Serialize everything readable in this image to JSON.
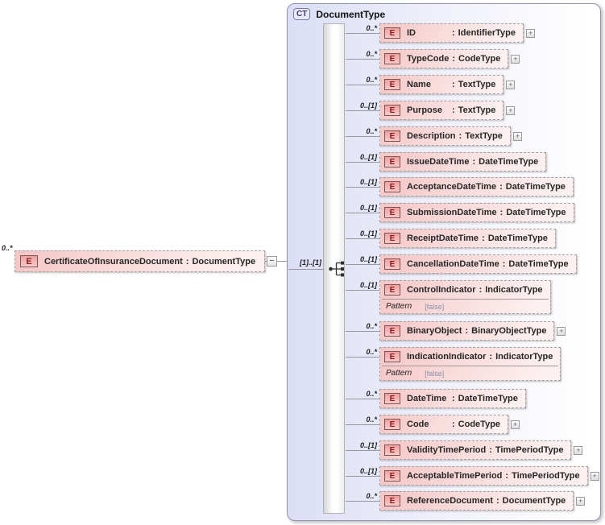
{
  "labels": {
    "colon": ":",
    "element_badge": "E",
    "expand_glyph": "+",
    "collapse_glyph": "−"
  },
  "root_element": {
    "cardinality": "0..*",
    "name": "CertificateOfInsuranceDocument",
    "type": "DocumentType"
  },
  "connector": {
    "occurrence": "[1]..[1]"
  },
  "complex_type": {
    "badge": "CT",
    "title": "DocumentType",
    "compositor": "sequence",
    "elements": [
      {
        "cardinality": "0..*",
        "name": "ID",
        "type": "IdentifierType",
        "expandable": true
      },
      {
        "cardinality": "0..*",
        "name": "TypeCode",
        "type": "CodeType",
        "expandable": true
      },
      {
        "cardinality": "0..*",
        "name": "Name",
        "type": "TextType",
        "expandable": true
      },
      {
        "cardinality": "0..[1]",
        "name": "Purpose",
        "type": "TextType",
        "expandable": true
      },
      {
        "cardinality": "0..*",
        "name": "Description",
        "type": "TextType",
        "expandable": true
      },
      {
        "cardinality": "0..[1]",
        "name": "IssueDateTime",
        "type": "DateTimeType",
        "expandable": false
      },
      {
        "cardinality": "0..[1]",
        "name": "AcceptanceDateTime",
        "type": "DateTimeType",
        "expandable": false
      },
      {
        "cardinality": "0..[1]",
        "name": "SubmissionDateTime",
        "type": "DateTimeType",
        "expandable": false
      },
      {
        "cardinality": "0..[1]",
        "name": "ReceiptDateTime",
        "type": "DateTimeType",
        "expandable": false
      },
      {
        "cardinality": "0..[1]",
        "name": "CancellationDateTime",
        "type": "DateTimeType",
        "expandable": false
      },
      {
        "cardinality": "0..[1]",
        "name": "ControlIndicator",
        "type": "IndicatorType",
        "expandable": false,
        "facet": {
          "label": "Pattern",
          "value": "[false]"
        }
      },
      {
        "cardinality": "0..*",
        "name": "BinaryObject",
        "type": "BinaryObjectType",
        "expandable": true
      },
      {
        "cardinality": "0..*",
        "name": "IndicationIndicator",
        "type": "IndicatorType",
        "expandable": false,
        "facet": {
          "label": "Pattern",
          "value": "[false]"
        }
      },
      {
        "cardinality": "0..*",
        "name": "DateTime",
        "type": "DateTimeType",
        "expandable": false
      },
      {
        "cardinality": "0..*",
        "name": "Code",
        "type": "CodeType",
        "expandable": true
      },
      {
        "cardinality": "0..[1]",
        "name": "ValidityTimePeriod",
        "type": "TimePeriodType",
        "expandable": true
      },
      {
        "cardinality": "0..[1]",
        "name": "AcceptableTimePeriod",
        "type": "TimePeriodType",
        "expandable": true
      },
      {
        "cardinality": "0..*",
        "name": "ReferenceDocument",
        "type": "DocumentType",
        "expandable": true
      }
    ]
  },
  "colors": {
    "panel_fill": "#dbdef5",
    "panel_border": "#9494ac",
    "element_fill": "#f5c6c6",
    "element_border": "#a3a3a3",
    "badge_fill": "#efa0a0",
    "badge_letter": "#8b1c1c",
    "connector_line": "#98989e",
    "facet_value_text": "#8a92aa"
  }
}
